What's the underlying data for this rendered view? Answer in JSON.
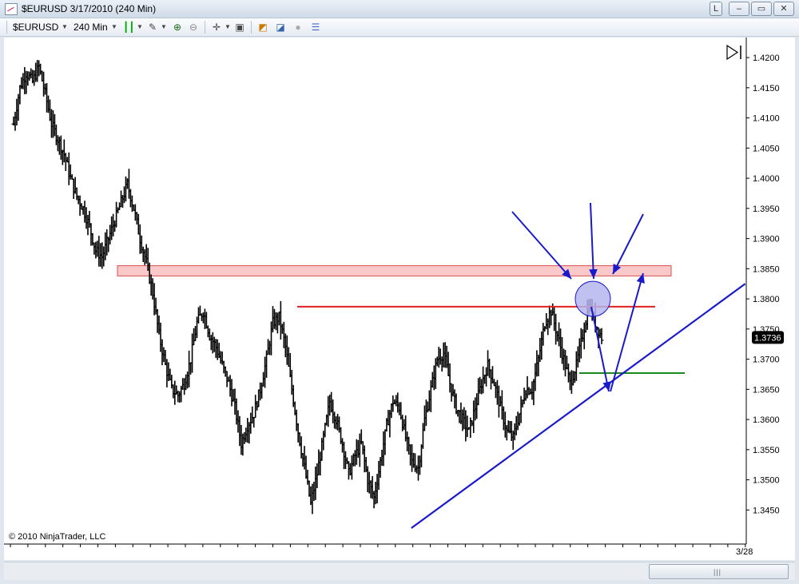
{
  "window": {
    "title": "$EURUSD  3/17/2010 (240 Min)",
    "buttons": [
      "L",
      "–",
      "▭",
      "✕"
    ]
  },
  "toolbar": {
    "instrument": "$EURUSD",
    "period": "240 Min"
  },
  "chart_data": {
    "type": "ohlc-bar",
    "instrument": "$EURUSD",
    "period": "240 Min",
    "ylim": [
      1.342,
      1.422
    ],
    "y_ticks": [
      "1.4200",
      "1.4150",
      "1.4100",
      "1.4050",
      "1.4000",
      "1.3950",
      "1.3900",
      "1.3850",
      "1.3800",
      "1.3750",
      "1.3700",
      "1.3650",
      "1.3600",
      "1.3550",
      "1.3500",
      "1.3450"
    ],
    "x_tick_labels": [
      "3/28"
    ],
    "last_price": "1.3736",
    "copyright": "© 2010 NinjaTrader, LLC",
    "price_path": [
      1.409,
      1.415,
      1.4175,
      1.416,
      1.4185,
      1.414,
      1.409,
      1.4065,
      1.404,
      1.4,
      1.397,
      1.395,
      1.392,
      1.388,
      1.387,
      1.39,
      1.393,
      1.396,
      1.399,
      1.395,
      1.39,
      1.386,
      1.381,
      1.374,
      1.369,
      1.365,
      1.364,
      1.366,
      1.37,
      1.376,
      1.378,
      1.374,
      1.372,
      1.369,
      1.366,
      1.362,
      1.356,
      1.359,
      1.361,
      1.365,
      1.37,
      1.376,
      1.377,
      1.372,
      1.365,
      1.358,
      1.352,
      1.346,
      1.351,
      1.357,
      1.363,
      1.36,
      1.356,
      1.351,
      1.354,
      1.356,
      1.35,
      1.347,
      1.353,
      1.359,
      1.363,
      1.362,
      1.357,
      1.353,
      1.352,
      1.36,
      1.365,
      1.37,
      1.371,
      1.366,
      1.362,
      1.36,
      1.358,
      1.362,
      1.366,
      1.369,
      1.366,
      1.362,
      1.358,
      1.357,
      1.361,
      1.365,
      1.365,
      1.37,
      1.376,
      1.378,
      1.374,
      1.37,
      1.366,
      1.369,
      1.374,
      1.379,
      1.376,
      1.3736
    ],
    "resistance_zone": [
      1.3838,
      1.3855
    ],
    "resistance_line": 1.3787,
    "support_line": 1.3677,
    "trendline": [
      [
        0.515,
        1.342
      ],
      [
        0.937,
        1.3825
      ]
    ],
    "annotation_circle": 1.38,
    "colors": {
      "bars": "#000000",
      "zone_fill": "#f9c9c9",
      "zone_stroke": "#d85050",
      "resistance": "#e02020",
      "support": "#1a8a1a",
      "annotations": "#1a1acc",
      "circle_fill": "#b5b5ee"
    }
  }
}
